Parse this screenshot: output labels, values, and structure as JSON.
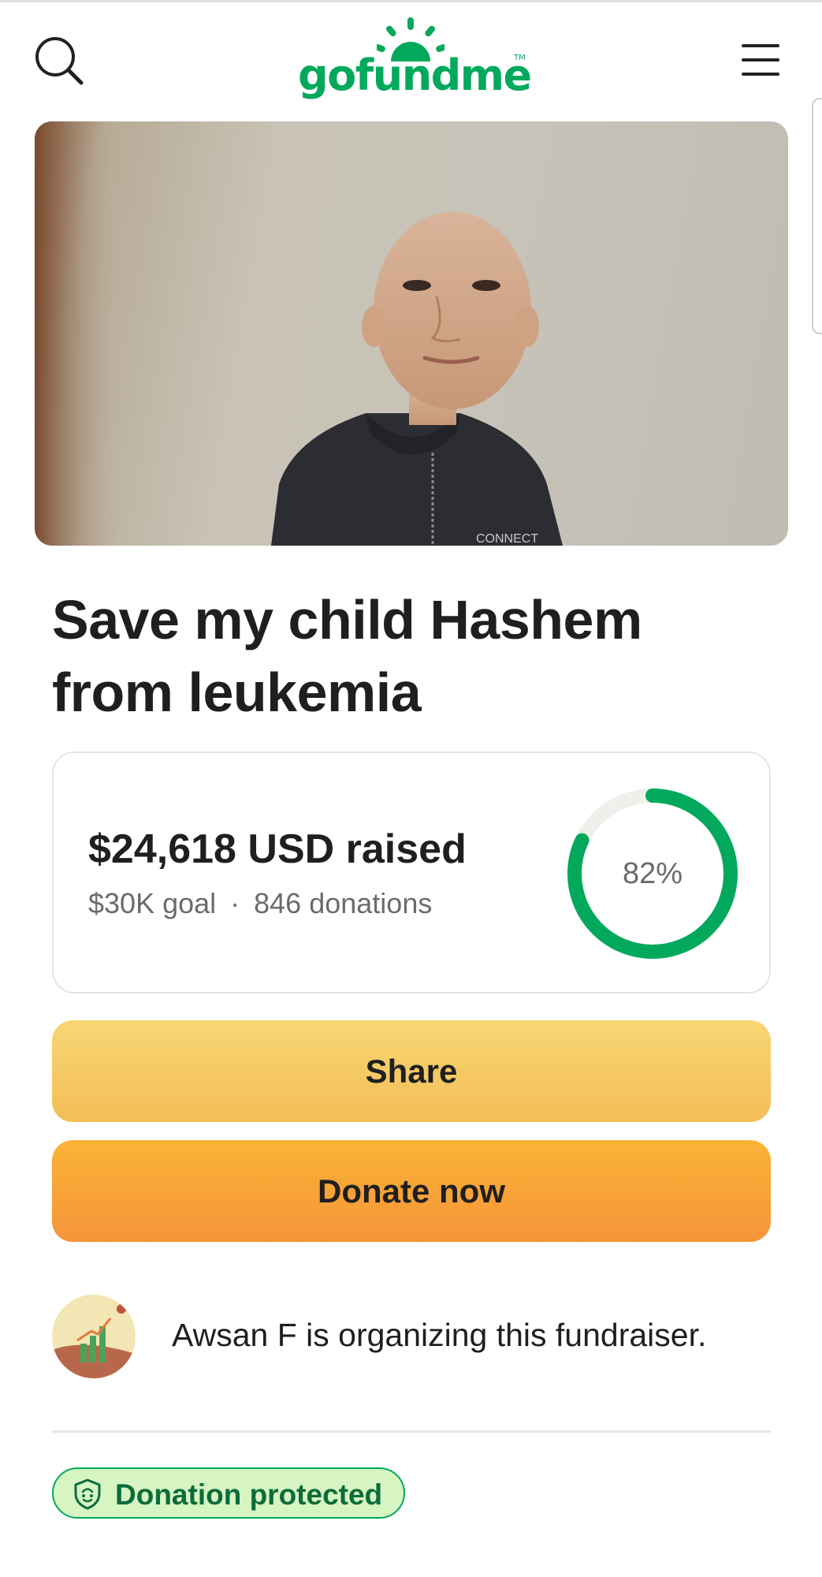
{
  "header": {
    "logo_text": "gofundme",
    "logo_tm": "TM",
    "search_icon": "search-icon",
    "menu_icon": "hamburger-menu-icon"
  },
  "hero": {
    "shirt_text": "CONNECT"
  },
  "fundraiser": {
    "title": "Save my child Hashem from leukemia"
  },
  "progress": {
    "raised": "$24,618 USD raised",
    "goal": "$30K goal",
    "separator": "·",
    "donations": "846 donations",
    "percent_label": "82%",
    "percent_value": 0.82,
    "ring_color": "#02a95c",
    "track_color": "#efefec"
  },
  "actions": {
    "share_label": "Share",
    "donate_label": "Donate now"
  },
  "organizer": {
    "text": "Awsan F is organizing this fundraiser."
  },
  "badge": {
    "label": "Donation protected",
    "icon": "shield-icon"
  },
  "colors": {
    "brand_green": "#02a95c",
    "share_yellow": "#f6c964",
    "donate_orange": "#f7a535",
    "badge_bg": "#d6f5c2"
  }
}
